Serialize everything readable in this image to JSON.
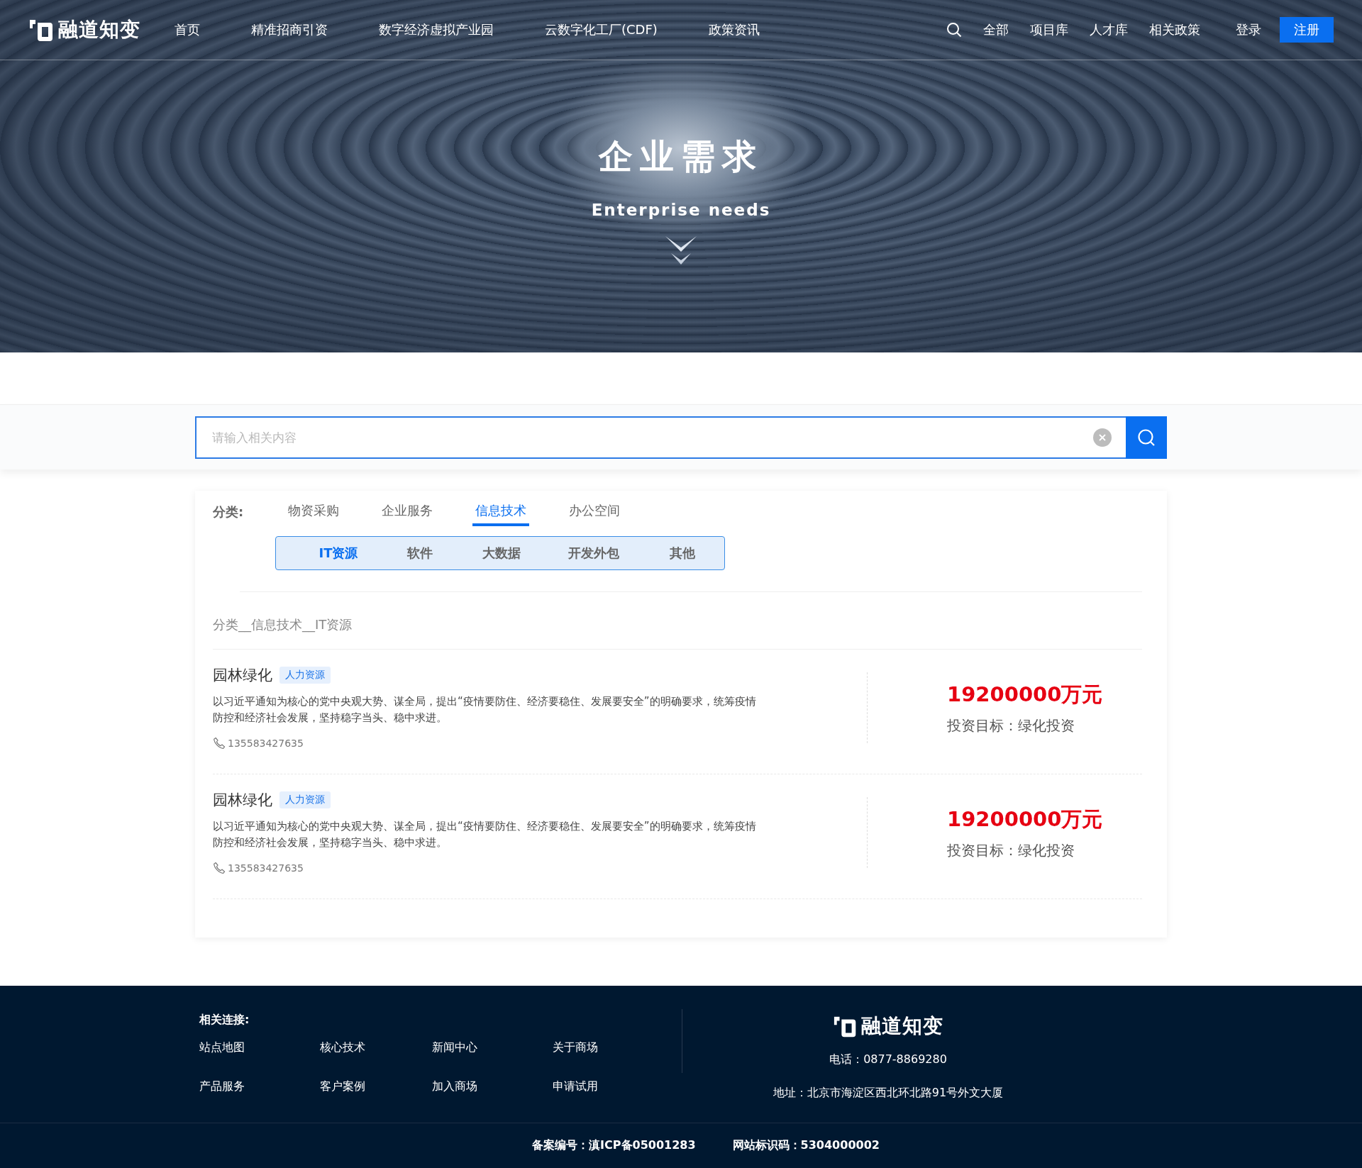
{
  "header": {
    "logo_text": "融道知变",
    "nav": [
      {
        "label": "首页",
        "selected": false
      },
      {
        "label": "精准招商引资",
        "selected": false
      },
      {
        "label": "数字经济虚拟产业园",
        "selected": false
      },
      {
        "label": "云数字化工厂(CDF)",
        "selected": false
      },
      {
        "label": "政策资讯",
        "selected": false
      }
    ],
    "quick_links": [
      "全部",
      "项目库",
      "人才库",
      "相关政策"
    ],
    "login": "登录",
    "register": "注册"
  },
  "hero": {
    "title": "企业需求",
    "subtitle": "Enterprise needs"
  },
  "search": {
    "placeholder": "请输入相关内容"
  },
  "filters": {
    "label": "分类:",
    "categories": [
      {
        "label": "物资采购",
        "selected": false
      },
      {
        "label": "企业服务",
        "selected": false
      },
      {
        "label": "信息技术",
        "selected": true
      },
      {
        "label": "办公空间",
        "selected": false
      }
    ],
    "subcategories": [
      {
        "label": "IT资源",
        "selected": true
      },
      {
        "label": "软件",
        "selected": false
      },
      {
        "label": "大数据",
        "selected": false
      },
      {
        "label": "开发外包",
        "selected": false
      },
      {
        "label": "其他",
        "selected": false
      }
    ]
  },
  "breadcrumb": "分类__信息技术__IT资源",
  "results": [
    {
      "title": "园林绿化",
      "tag": "人力资源",
      "description": "以习近平通知为核心的党中央观大势、谋全局，提出“疫情要防住、经济要稳住、发展要安全”的明确要求，统筹疫情防控和经济社会发展，坚持稳字当头、稳中求进。",
      "phone": "135583427635",
      "amount": "19200000万元",
      "target": "投资目标：绿化投资"
    },
    {
      "title": "园林绿化",
      "tag": "人力资源",
      "description": "以习近平通知为核心的党中央观大势、谋全局，提出“疫情要防住、经济要稳住、发展要安全”的明确要求，统筹疫情防控和经济社会发展，坚持稳字当头、稳中求进。",
      "phone": "135583427635",
      "amount": "19200000万元",
      "target": "投资目标：绿化投资"
    }
  ],
  "footer": {
    "links_title": "相关连接:",
    "links": [
      "站点地图",
      "核心技术",
      "新闻中心",
      "关于商场",
      "产品服务",
      "客户案例",
      "加入商场",
      "申请试用"
    ],
    "logo_text": "融道知变",
    "phone": "电话：0877-8869280",
    "address": "地址：北京市海淀区西北环北路91号外文大厦",
    "record": "备案编号：滇ICP备05001283",
    "site_id": "网站标识码：5304000002"
  }
}
